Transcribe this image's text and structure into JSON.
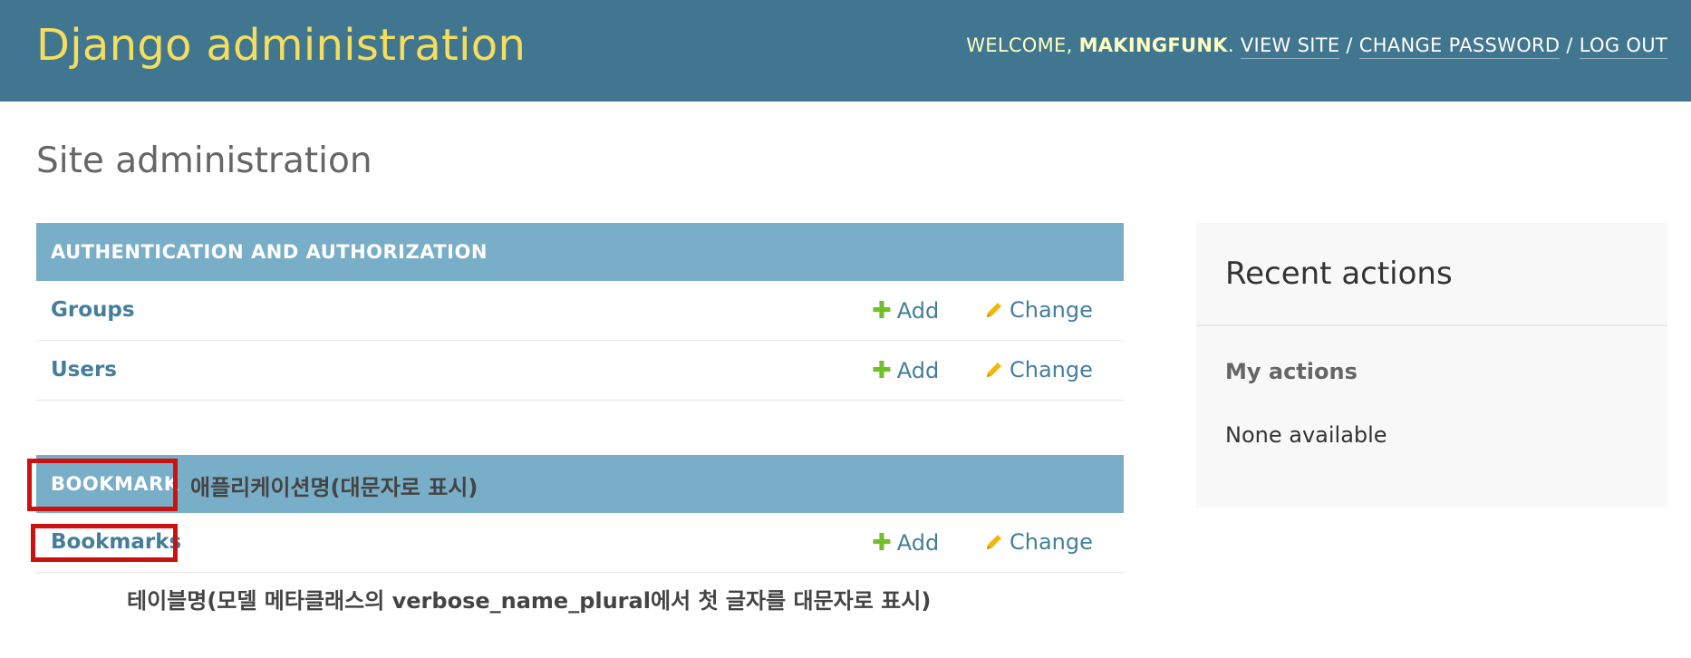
{
  "header": {
    "branding": "Django administration",
    "welcome_prefix": "WELCOME, ",
    "username": "MAKINGFUNK",
    "username_suffix": ".",
    "view_site": "VIEW SITE",
    "separator": " / ",
    "change_password": "CHANGE PASSWORD",
    "log_out": "LOG OUT"
  },
  "page_title": "Site administration",
  "modules": [
    {
      "caption": "AUTHENTICATION AND AUTHORIZATION",
      "models": [
        {
          "name": "Groups",
          "add": "Add",
          "change": "Change"
        },
        {
          "name": "Users",
          "add": "Add",
          "change": "Change"
        }
      ]
    },
    {
      "caption": "BOOKMARK",
      "models": [
        {
          "name": "Bookmarks",
          "add": "Add",
          "change": "Change"
        }
      ]
    }
  ],
  "recent_actions": {
    "title": "Recent actions",
    "my_actions": "My actions",
    "none_available": "None available"
  },
  "annotations": {
    "app_name_note": "애플리케이션명(대문자로 표시)",
    "table_name_note": "테이블명(모델 메타클래스의 verbose_name_plural에서 첫 글자를 대문자로 표시)"
  },
  "colors": {
    "header_bg": "#417690",
    "branding": "#f5dd5d",
    "module_caption_bg": "#79aec8",
    "link": "#447e9b",
    "add_icon": "#70bf2b",
    "change_icon": "#efb80b",
    "annotation_box": "#cc1111"
  },
  "icons": {
    "add": "plus-icon",
    "change": "pencil-icon"
  }
}
